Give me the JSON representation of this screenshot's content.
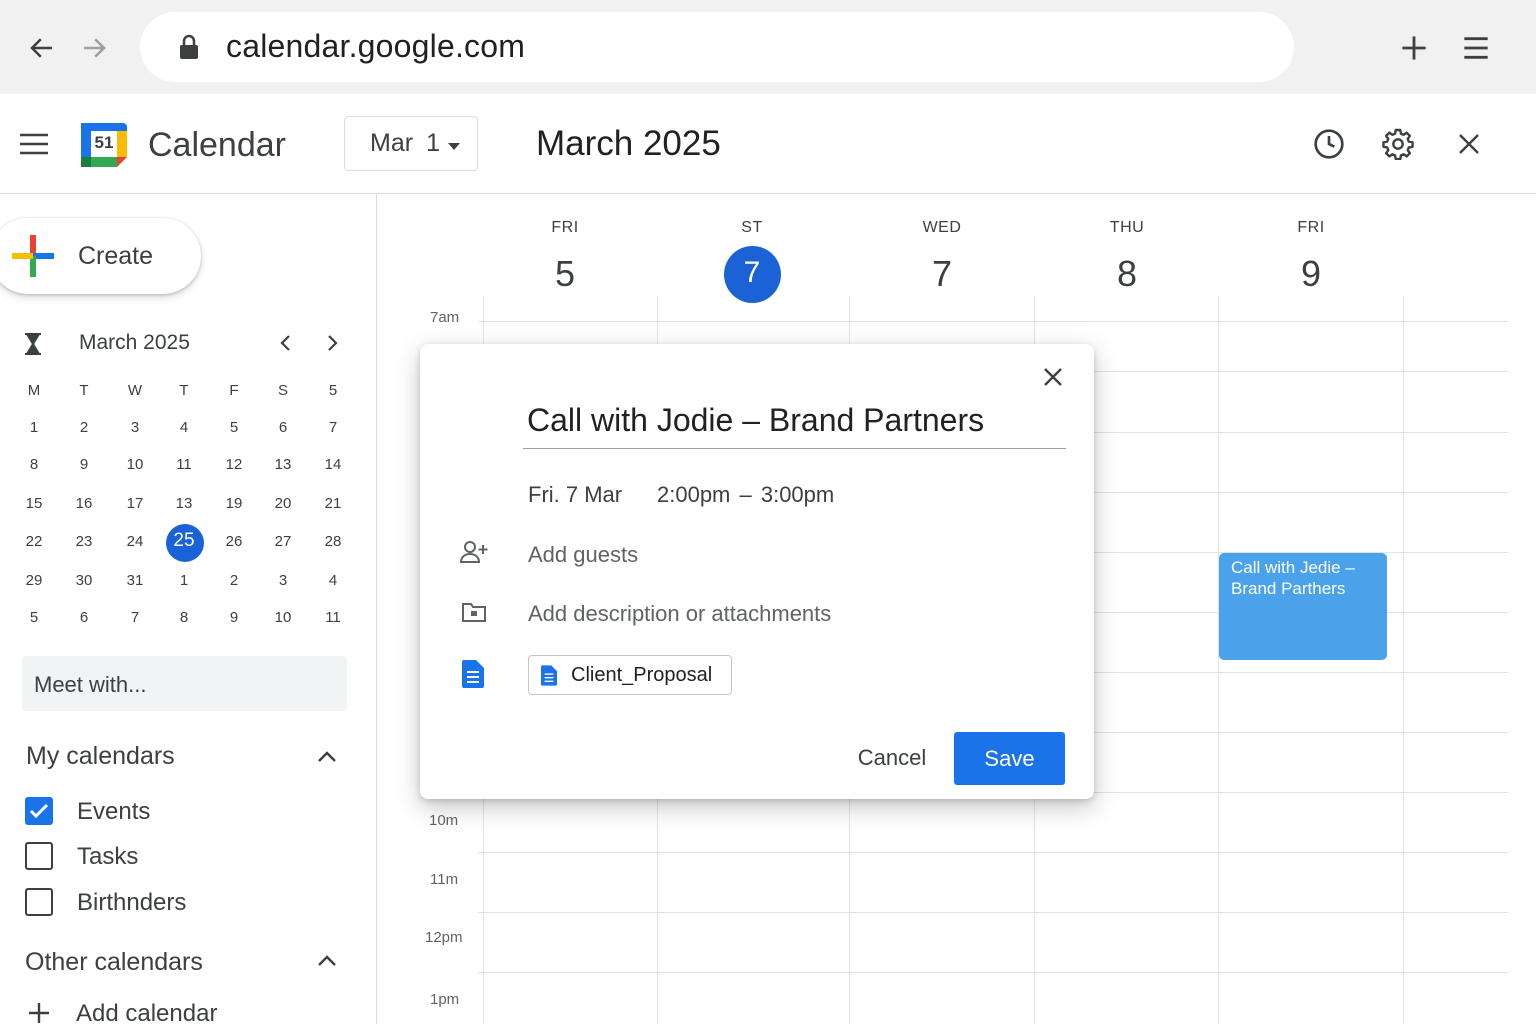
{
  "browser": {
    "url": "calendar.google.com",
    "icons": [
      "back-arrow-icon",
      "forward-arrow-icon",
      "lock-icon",
      "new-tab-plus-icon",
      "menu-icon"
    ]
  },
  "header": {
    "app_title": "Calendar",
    "logo_number": "51",
    "date_picker": {
      "month": "Mar",
      "day": "1"
    },
    "month_heading": "March 2025",
    "icons": [
      "hamburger-menu-icon",
      "history-clock-icon",
      "settings-gear-icon",
      "close-icon"
    ]
  },
  "sidebar": {
    "create_label": "Create",
    "mini_calendar": {
      "title": "March 2025",
      "weekdays": [
        "M",
        "T",
        "W",
        "T",
        "F",
        "S",
        "5"
      ],
      "weeks": [
        [
          "1",
          "2",
          "3",
          "4",
          "5",
          "6",
          "7"
        ],
        [
          "8",
          "9",
          "10",
          "11",
          "12",
          "13",
          "14"
        ],
        [
          "15",
          "16",
          "17",
          "13",
          "19",
          "20",
          "21"
        ],
        [
          "22",
          "23",
          "24",
          "25",
          "26",
          "27",
          "28"
        ],
        [
          "29",
          "30",
          "31",
          "1",
          "2",
          "3",
          "4"
        ],
        [
          "5",
          "6",
          "7",
          "8",
          "9",
          "10",
          "11"
        ]
      ],
      "selected_day": "25"
    },
    "meet_with": "Meet with...",
    "my_calendars": {
      "title": "My calendars",
      "items": [
        {
          "label": "Events",
          "checked": true
        },
        {
          "label": "Tasks",
          "checked": false
        },
        {
          "label": "Birthnders",
          "checked": false
        }
      ]
    },
    "other_calendars": {
      "title": "Other calendars",
      "add_label": "Add calendar"
    }
  },
  "grid": {
    "days": [
      {
        "name": "FRI",
        "num": "5"
      },
      {
        "name": "ST",
        "num": "7",
        "today": true
      },
      {
        "name": "WED",
        "num": "7"
      },
      {
        "name": "THU",
        "num": "8"
      },
      {
        "name": "FRI",
        "num": "9"
      }
    ],
    "time_labels": [
      "7am",
      "10m",
      "11m",
      "12pm",
      "1pm"
    ],
    "event": {
      "title": "Call with Jedie – Brand Parthers"
    }
  },
  "dialog": {
    "title": "Call with Jodie – Brand Partners",
    "date": "Fri. 7 Mar",
    "time": "2:00pm – 3:00pm",
    "add_guests": "Add guests",
    "add_description": "Add description or attachments",
    "attachment": "Client_Proposal",
    "cancel_label": "Cancel",
    "save_label": "Save"
  },
  "colors": {
    "accent": "#1a73e8",
    "today": "#1a62d6",
    "event": "#4aa3ea"
  }
}
